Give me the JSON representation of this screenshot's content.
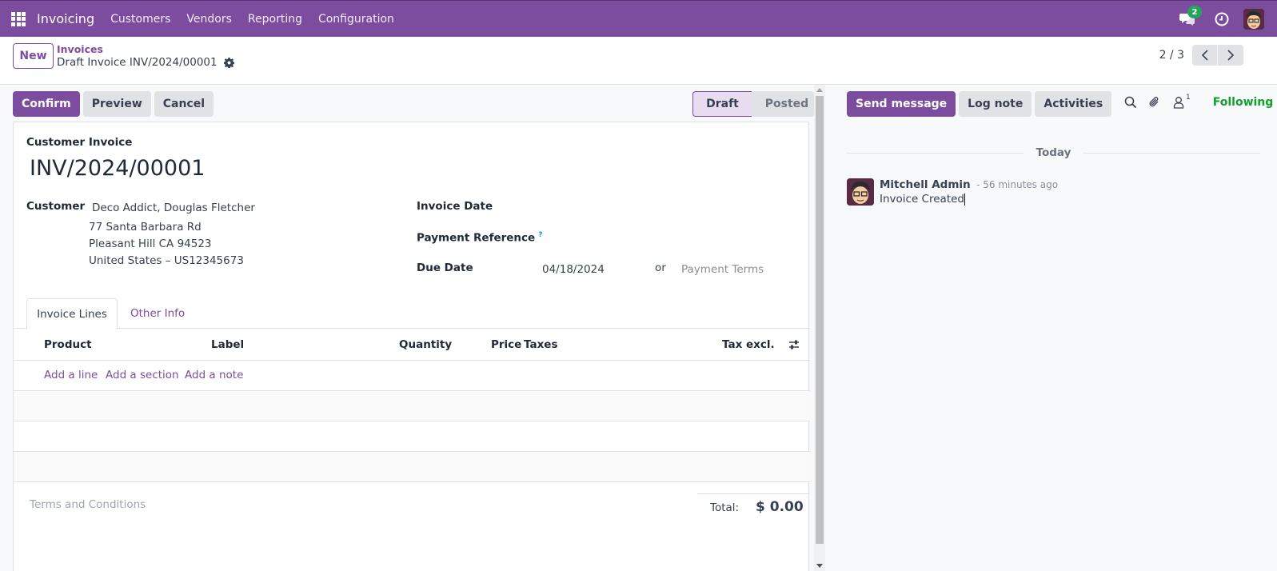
{
  "navbar": {
    "app_name": "Invoicing",
    "menu": [
      "Customers",
      "Vendors",
      "Reporting",
      "Configuration"
    ],
    "messages_badge": "2",
    "icons": [
      "apps-grid-icon",
      "chat-icon",
      "clock-icon",
      "user-avatar"
    ]
  },
  "control_panel": {
    "new_label": "New",
    "breadcrumb_parent": "Invoices",
    "breadcrumb_current": "Draft Invoice INV/2024/00001",
    "pager_value": "2 / 3"
  },
  "form": {
    "actions": {
      "confirm": "Confirm",
      "preview": "Preview",
      "cancel": "Cancel"
    },
    "status_steps": [
      {
        "label": "Draft",
        "active": true
      },
      {
        "label": "Posted",
        "active": false
      }
    ],
    "doc_type": "Customer Invoice",
    "doc_name": "INV/2024/00001",
    "customer": {
      "label": "Customer",
      "name": "Deco Addict, Douglas Fletcher",
      "address_line1": "77 Santa Barbara Rd",
      "address_line2": "Pleasant Hill CA 94523",
      "address_line3": "United States – US12345673"
    },
    "invoice_date": {
      "label": "Invoice Date",
      "value": ""
    },
    "payment_reference": {
      "label": "Payment Reference",
      "help": "?",
      "value": ""
    },
    "due_date": {
      "label": "Due Date",
      "value": "04/18/2024",
      "or": "or",
      "payment_terms_placeholder": "Payment Terms"
    },
    "tabs": [
      {
        "label": "Invoice Lines",
        "active": true
      },
      {
        "label": "Other Info",
        "active": false
      }
    ],
    "lines": {
      "columns": [
        "Product",
        "Label",
        "Quantity",
        "Price",
        "Taxes",
        "Tax excl."
      ],
      "add_line": "Add a line",
      "add_section": "Add a section",
      "add_note": "Add a note",
      "rows": []
    },
    "terms_placeholder": "Terms and Conditions",
    "total_label": "Total:",
    "total_value": "$ 0.00"
  },
  "chatter": {
    "send_message": "Send message",
    "log_note": "Log note",
    "activities": "Activities",
    "followers_count": "1",
    "following_label": "Following",
    "date_separator": "Today",
    "messages": [
      {
        "author": "Mitchell Admin",
        "date": "- 56 minutes ago",
        "body": "Invoice Created"
      }
    ]
  },
  "colors": {
    "brand": "#7c4d9f",
    "following": "#12a12d",
    "badge": "#23a55a"
  }
}
